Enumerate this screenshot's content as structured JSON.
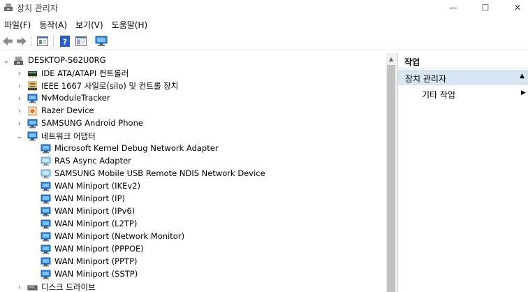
{
  "window": {
    "title": "장치 관리자",
    "controls": {
      "minimize": "—",
      "maximize": "☐",
      "close": "✕"
    }
  },
  "menu": [
    {
      "label": "파일(F)"
    },
    {
      "label": "동작(A)"
    },
    {
      "label": "보기(V)"
    },
    {
      "label": "도움말(H)"
    }
  ],
  "toolbar": {
    "icons": [
      "back-icon",
      "forward-icon",
      "properties-icon",
      "help-icon",
      "show-hide-pane-icon",
      "monitor-icon"
    ]
  },
  "tree": {
    "root": "DESKTOP-S62U0RG",
    "items": [
      {
        "label": "IDE ATA/ATAPI 컨트롤러",
        "icon": "ide-controller-icon",
        "expander": "›"
      },
      {
        "label": "IEEE 1667 사일로(silo) 및 컨트롤 장치",
        "icon": "ieee-silo-icon",
        "expander": "›"
      },
      {
        "label": "NvModuleTracker",
        "icon": "nv-module-tracker-icon",
        "expander": "›"
      },
      {
        "label": "Razer Device",
        "icon": "razer-device-icon",
        "expander": "›"
      },
      {
        "label": "SAMSUNG Android Phone",
        "icon": "samsung-phone-icon",
        "expander": "›"
      },
      {
        "label": "네트워크 어댑터",
        "icon": "network-adapter-icon",
        "expander": "⌄"
      }
    ],
    "network_adapters": [
      {
        "label": "Microsoft Kernel Debug Network Adapter"
      },
      {
        "label": "RAS Async Adapter"
      },
      {
        "label": "SAMSUNG Mobile USB Remote NDIS Network Device"
      },
      {
        "label": "WAN Miniport (IKEv2)"
      },
      {
        "label": "WAN Miniport (IP)"
      },
      {
        "label": "WAN Miniport (IPv6)"
      },
      {
        "label": "WAN Miniport (L2TP)"
      },
      {
        "label": "WAN Miniport (Network Monitor)"
      },
      {
        "label": "WAN Miniport (PPPOE)"
      },
      {
        "label": "WAN Miniport (PPTP)"
      },
      {
        "label": "WAN Miniport (SSTP)"
      }
    ],
    "after": [
      {
        "label": "디스크 드라이브",
        "icon": "disk-drive-icon",
        "expander": "›"
      }
    ]
  },
  "actions": {
    "header": "작업",
    "section": "장치 관리자",
    "section_arrow": "▲",
    "items": [
      {
        "label": "기타 작업",
        "arrow": "▶"
      }
    ]
  },
  "colors": {
    "selected_section": "#d7e4f2",
    "monitor_blue": "#2e86de",
    "help_blue": "#2a5bd7"
  }
}
